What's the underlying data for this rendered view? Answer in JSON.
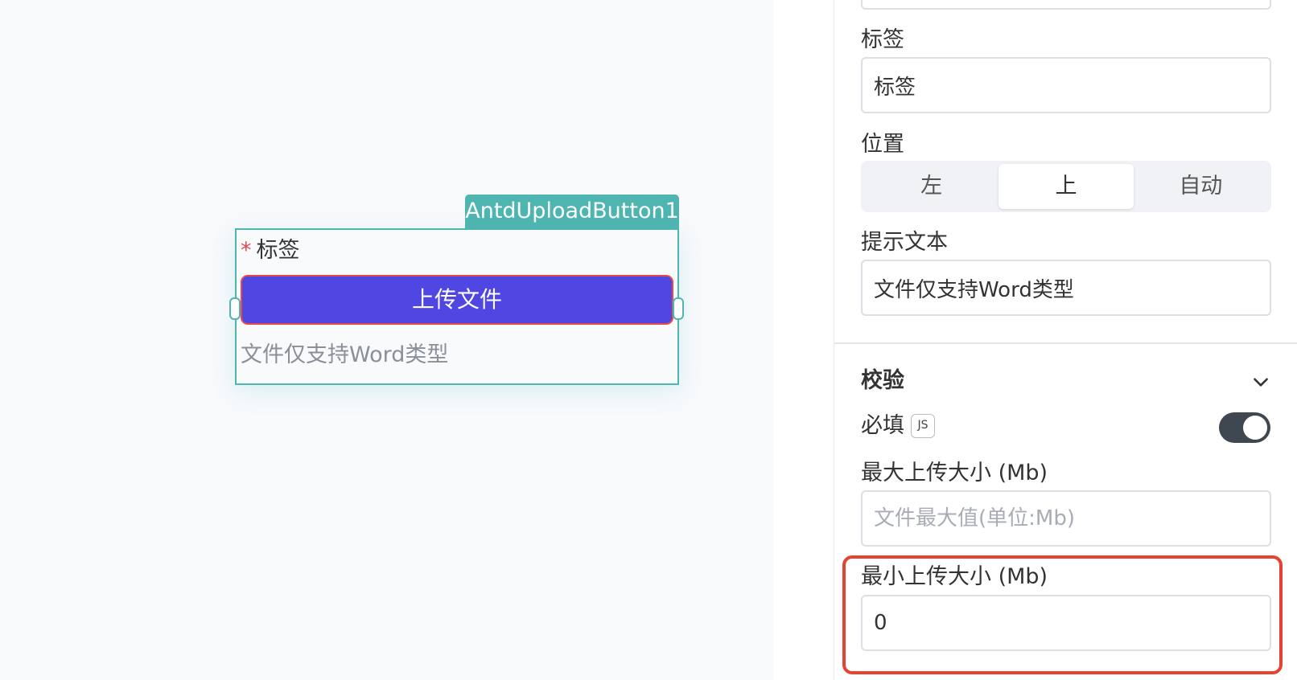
{
  "canvas": {
    "component_tag": "AntdUploadButton1",
    "label_required_mark": "*",
    "label": "标签",
    "upload_button_label": "上传文件",
    "hint": "文件仅支持Word类型"
  },
  "panel": {
    "label_field": {
      "title": "标签",
      "value": "标签"
    },
    "position_field": {
      "title": "位置",
      "options": [
        "左",
        "上",
        "自动"
      ],
      "selected": "上"
    },
    "hint_field": {
      "title": "提示文本",
      "value": "文件仅支持Word类型"
    },
    "validation": {
      "title": "校验",
      "required": {
        "label": "必填",
        "js_badge": "JS",
        "enabled": true
      },
      "max_size": {
        "title": "最大上传大小 (Mb)",
        "placeholder": "文件最大值(单位:Mb)",
        "value": ""
      },
      "min_size": {
        "title": "最小上传大小 (Mb)",
        "value": "0"
      }
    }
  },
  "colors": {
    "accent_teal": "#4fb5b0",
    "upload_button": "#5046e1",
    "highlight_red": "#e5432f",
    "toggle_on": "#3f4750"
  }
}
